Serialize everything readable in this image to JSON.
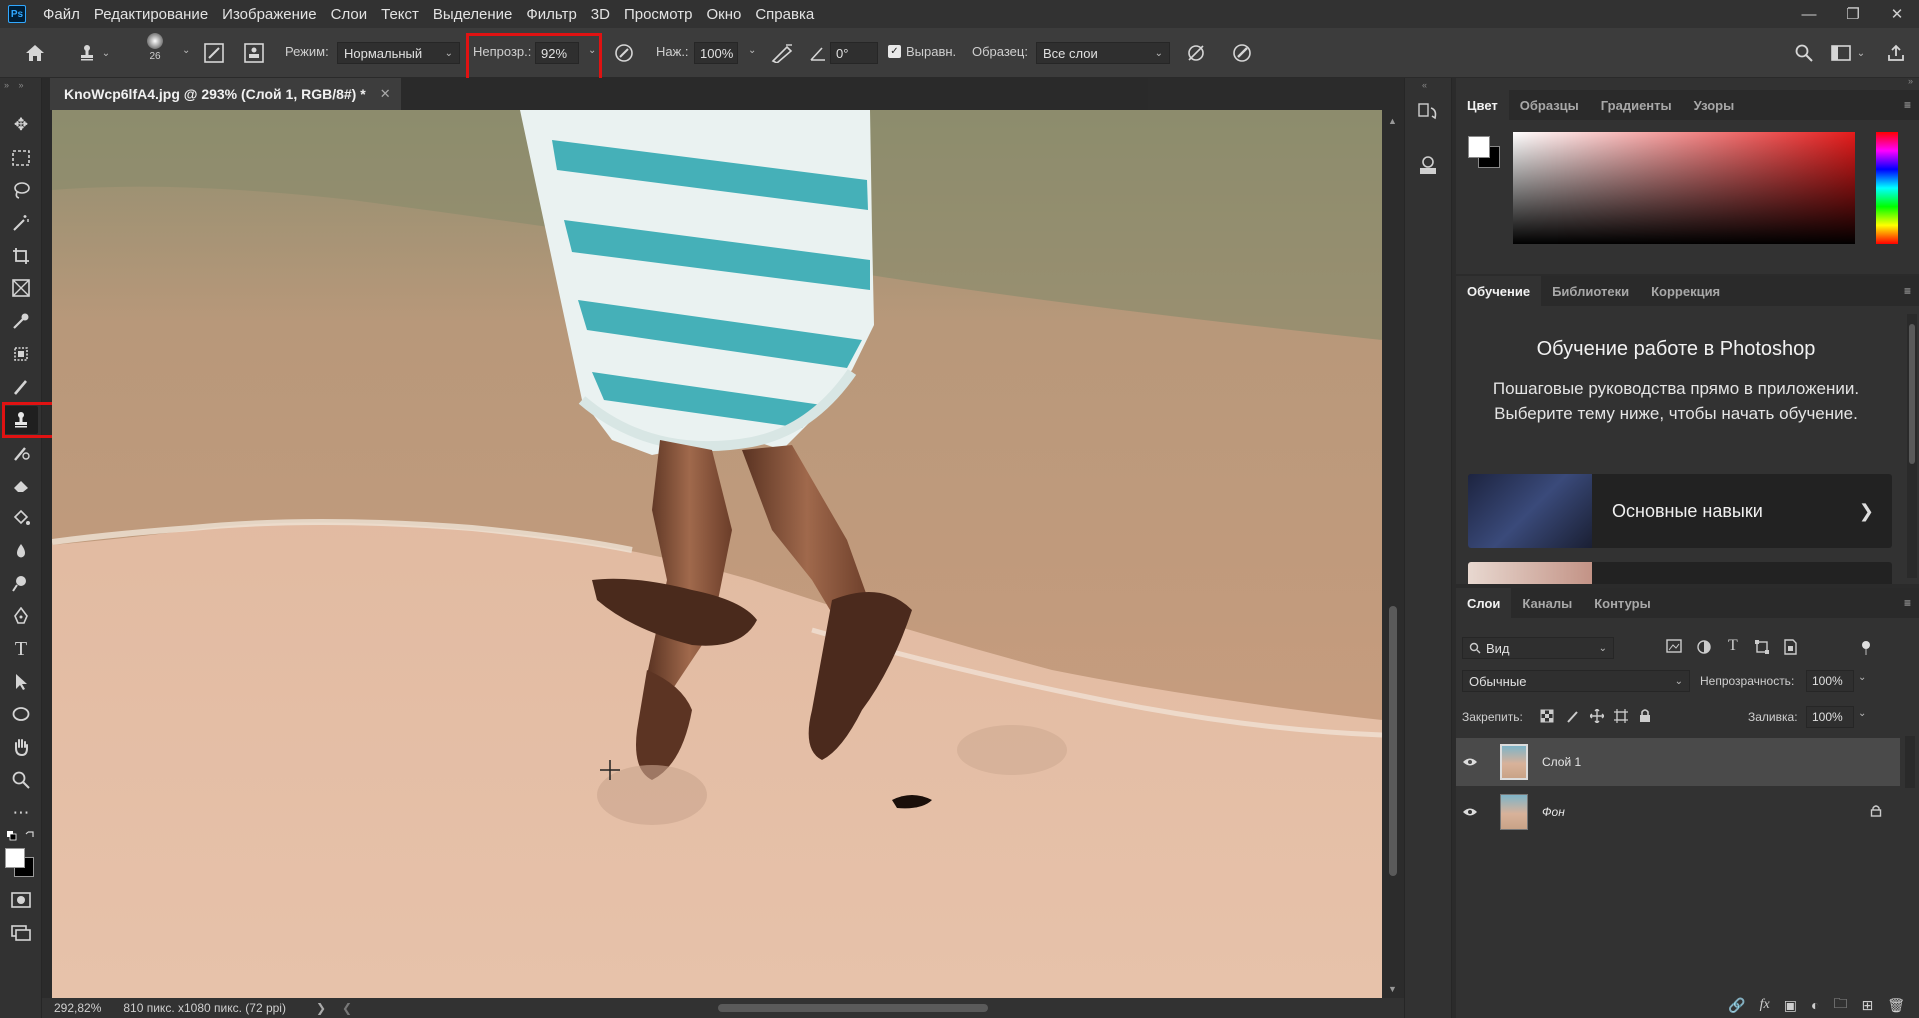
{
  "menubar": {
    "logo": "Ps",
    "items": [
      "Файл",
      "Редактирование",
      "Изображение",
      "Слои",
      "Текст",
      "Выделение",
      "Фильтр",
      "3D",
      "Просмотр",
      "Окно",
      "Справка"
    ]
  },
  "options": {
    "brush_size": "26",
    "mode_label": "Режим:",
    "mode_value": "Нормальный",
    "opacity_label": "Непрозр.:",
    "opacity_value": "92%",
    "pressure_label": "Наж.:",
    "pressure_value": "100%",
    "angle_value": "0°",
    "aligned_label": "Выравн.",
    "sample_label": "Образец:",
    "sample_value": "Все слои"
  },
  "document": {
    "tab_title": "KnoWcp6lfA4.jpg @ 293% (Слой 1, RGB/8#) *"
  },
  "status": {
    "zoom": "292,82%",
    "doc_info": "810 пикс. x1080 пикс. (72 ppi)"
  },
  "color_panel": {
    "tabs": [
      "Цвет",
      "Образцы",
      "Градиенты",
      "Узоры"
    ]
  },
  "learn_panel": {
    "tabs": [
      "Обучение",
      "Библиотеки",
      "Коррекция"
    ],
    "title": "Обучение работе в Photoshop",
    "description": "Пошаговые руководства прямо в приложении. Выберите тему ниже, чтобы начать обучение.",
    "card_label": "Основные навыки"
  },
  "layers_panel": {
    "tabs": [
      "Слои",
      "Каналы",
      "Контуры"
    ],
    "filter_label": "Вид",
    "blend_mode": "Обычные",
    "opacity_label": "Непрозрачность:",
    "opacity_value": "100%",
    "lock_label": "Закрепить:",
    "fill_label": "Заливка:",
    "fill_value": "100%",
    "layers": [
      {
        "name": "Слой 1"
      },
      {
        "name": "Фон"
      }
    ]
  },
  "colors": {
    "highlight": "#e01212",
    "accent": "#31a8ff"
  }
}
